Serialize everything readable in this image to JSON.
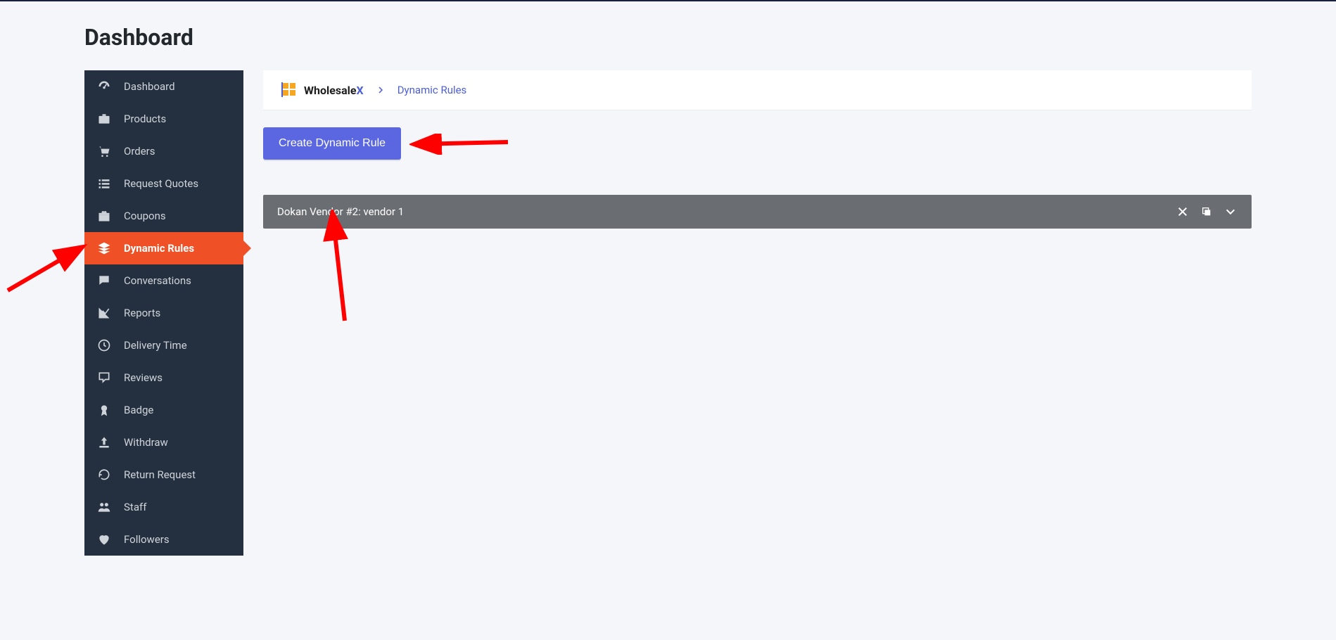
{
  "page": {
    "title": "Dashboard"
  },
  "sidebar": {
    "items": [
      {
        "label": "Dashboard",
        "icon": "gauge-icon",
        "active": false
      },
      {
        "label": "Products",
        "icon": "briefcase-icon",
        "active": false
      },
      {
        "label": "Orders",
        "icon": "cart-icon",
        "active": false
      },
      {
        "label": "Request Quotes",
        "icon": "list-icon",
        "active": false
      },
      {
        "label": "Coupons",
        "icon": "gift-icon",
        "active": false
      },
      {
        "label": "Dynamic Rules",
        "icon": "layers-icon",
        "active": true
      },
      {
        "label": "Conversations",
        "icon": "chat-icon",
        "active": false
      },
      {
        "label": "Reports",
        "icon": "chart-icon",
        "active": false
      },
      {
        "label": "Delivery Time",
        "icon": "clock-icon",
        "active": false
      },
      {
        "label": "Reviews",
        "icon": "comment-icon",
        "active": false
      },
      {
        "label": "Badge",
        "icon": "award-icon",
        "active": false
      },
      {
        "label": "Withdraw",
        "icon": "upload-icon",
        "active": false
      },
      {
        "label": "Return Request",
        "icon": "refresh-icon",
        "active": false
      },
      {
        "label": "Staff",
        "icon": "users-icon",
        "active": false
      },
      {
        "label": "Followers",
        "icon": "heart-icon",
        "active": false
      }
    ]
  },
  "breadcrumb": {
    "brand_main": "Wholesale",
    "brand_accent": "X",
    "current": "Dynamic Rules"
  },
  "actions": {
    "create_label": "Create Dynamic Rule"
  },
  "rules": [
    {
      "label": "Dokan Vendor #2: vendor 1"
    }
  ],
  "colors": {
    "primary": "#5a67e0",
    "sidebar": "#242f3f",
    "active": "#f05025",
    "annotation": "#ff0000"
  }
}
